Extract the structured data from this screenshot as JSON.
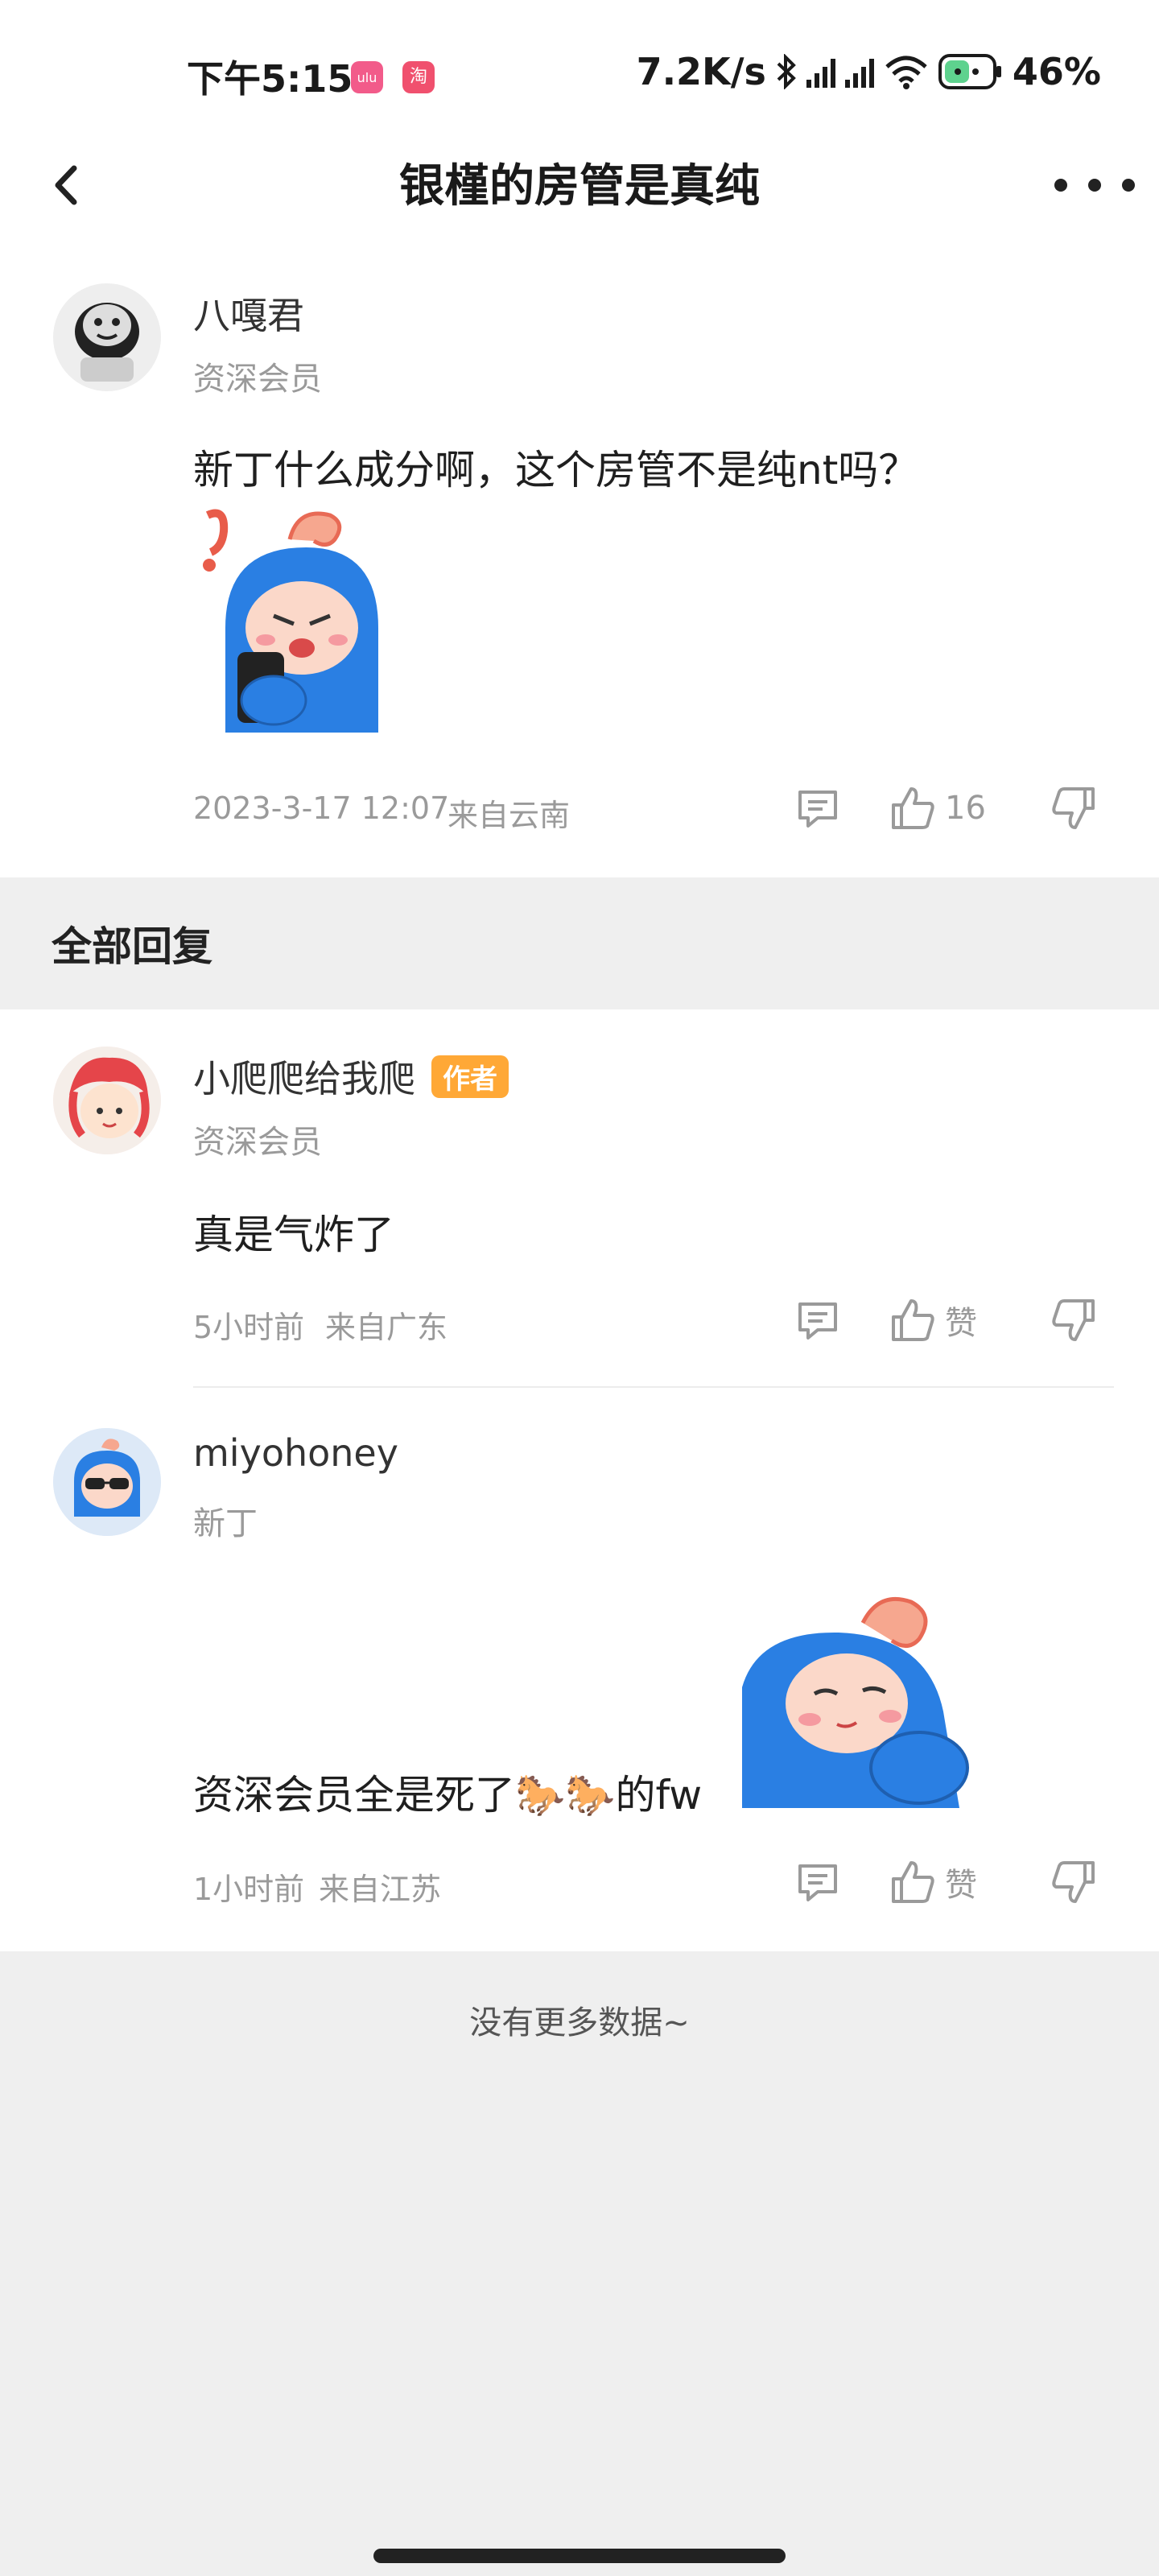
{
  "status_bar": {
    "time": "下午5:15",
    "app_icon_1": "ulu",
    "app_icon_2": "淘",
    "net_speed": "7.2K/s",
    "battery": "46%",
    "icons": [
      "bluetooth-icon",
      "signal-icon",
      "signal-icon",
      "wifi-icon",
      "battery-icon"
    ]
  },
  "nav": {
    "title": "银槿的房管是真纯",
    "back_icon": "chevron-left-icon",
    "more_icon": "more-dots-icon"
  },
  "main_post": {
    "username": "八嘎君",
    "level": "资深会员",
    "content": "新丁什么成分啊，这个房管不是纯nt吗？",
    "timestamp": "2023-3-17 12:07",
    "location": "来自云南",
    "like_count": "16"
  },
  "replies_section": {
    "title": "全部回复"
  },
  "replies": [
    {
      "username": "小爬爬给我爬",
      "badge": "作者",
      "level": "资深会员",
      "content": "真是气炸了",
      "time": "5小时前",
      "location": "来自广东",
      "like_label": "赞"
    },
    {
      "username": "miyohoney",
      "level": "新丁",
      "content": "资深会员全是死了🐎🐎的fw",
      "time": "1小时前",
      "location": "来自江苏",
      "like_label": "赞"
    }
  ],
  "footer": {
    "no_more": "没有更多数据~"
  },
  "colors": {
    "badge": "#ffa836",
    "mascot_blue": "#2a7fe3",
    "background": "#efefef"
  }
}
